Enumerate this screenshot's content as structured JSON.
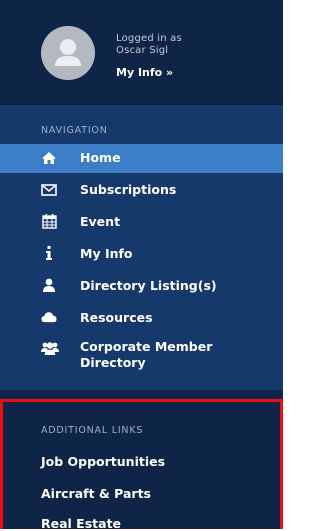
{
  "profile": {
    "logged_in_label": "Logged in as",
    "user_name": "Oscar Sigl",
    "my_info_link": "My Info »"
  },
  "navigation": {
    "heading": "NAVIGATION",
    "items": [
      {
        "label": "Home",
        "icon": "home-icon",
        "active": true
      },
      {
        "label": "Subscriptions",
        "icon": "envelope-icon",
        "active": false
      },
      {
        "label": "Event",
        "icon": "calendar-icon",
        "active": false
      },
      {
        "label": "My Info",
        "icon": "info-icon",
        "active": false
      },
      {
        "label": "Directory Listing(s)",
        "icon": "user-icon",
        "active": false
      },
      {
        "label": "Resources",
        "icon": "cloud-icon",
        "active": false
      },
      {
        "label": "Corporate Member Directory",
        "icon": "group-icon",
        "active": false
      }
    ]
  },
  "additional_links": {
    "heading": "ADDITIONAL LINKS",
    "items": [
      {
        "label": "Job Opportunities"
      },
      {
        "label": "Aircraft & Parts"
      },
      {
        "label": "Real Estate"
      }
    ]
  },
  "colors": {
    "sidebar_dark": "#0e2547",
    "nav_background": "#15396a",
    "active_item": "#3d7fc6",
    "highlight_border": "#ee0d12"
  }
}
